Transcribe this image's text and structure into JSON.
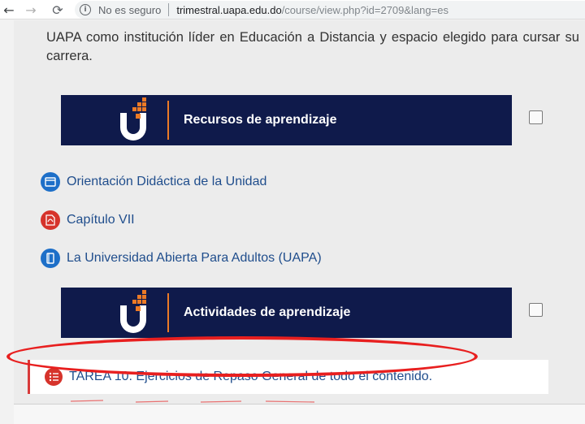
{
  "browser": {
    "security_text": "No es seguro",
    "url_host": "trimestral.uapa.edu.do",
    "url_path": "/course/view.php?id=2709&lang=es",
    "back_icon": "←",
    "forward_icon": "→",
    "reload_icon": "⟳",
    "info_icon": "i"
  },
  "content": {
    "intro_text": "UAPA como institución líder en Educación a Distancia y espacio elegido para cursar su carrera.",
    "sections": [
      {
        "title": "Recursos de aprendizaje"
      },
      {
        "title": "Actividades de aprendizaje"
      }
    ],
    "resources": [
      {
        "label": "Orientación Didáctica de la Unidad",
        "icon": "page-icon"
      },
      {
        "label": "Capítulo VII",
        "icon": "pdf-icon"
      },
      {
        "label": "La Universidad Abierta Para Adultos (UAPA)",
        "icon": "book-icon"
      }
    ],
    "activity": {
      "label": "TAREA 10. Ejercicios de Repaso General de todo el contenido.",
      "icon": "assignment-icon"
    }
  },
  "colors": {
    "banner_bg": "#0f1a4b",
    "accent_orange": "#ec7a26",
    "link_blue": "#1f4d8c",
    "highlight_red": "#e81f1f"
  }
}
